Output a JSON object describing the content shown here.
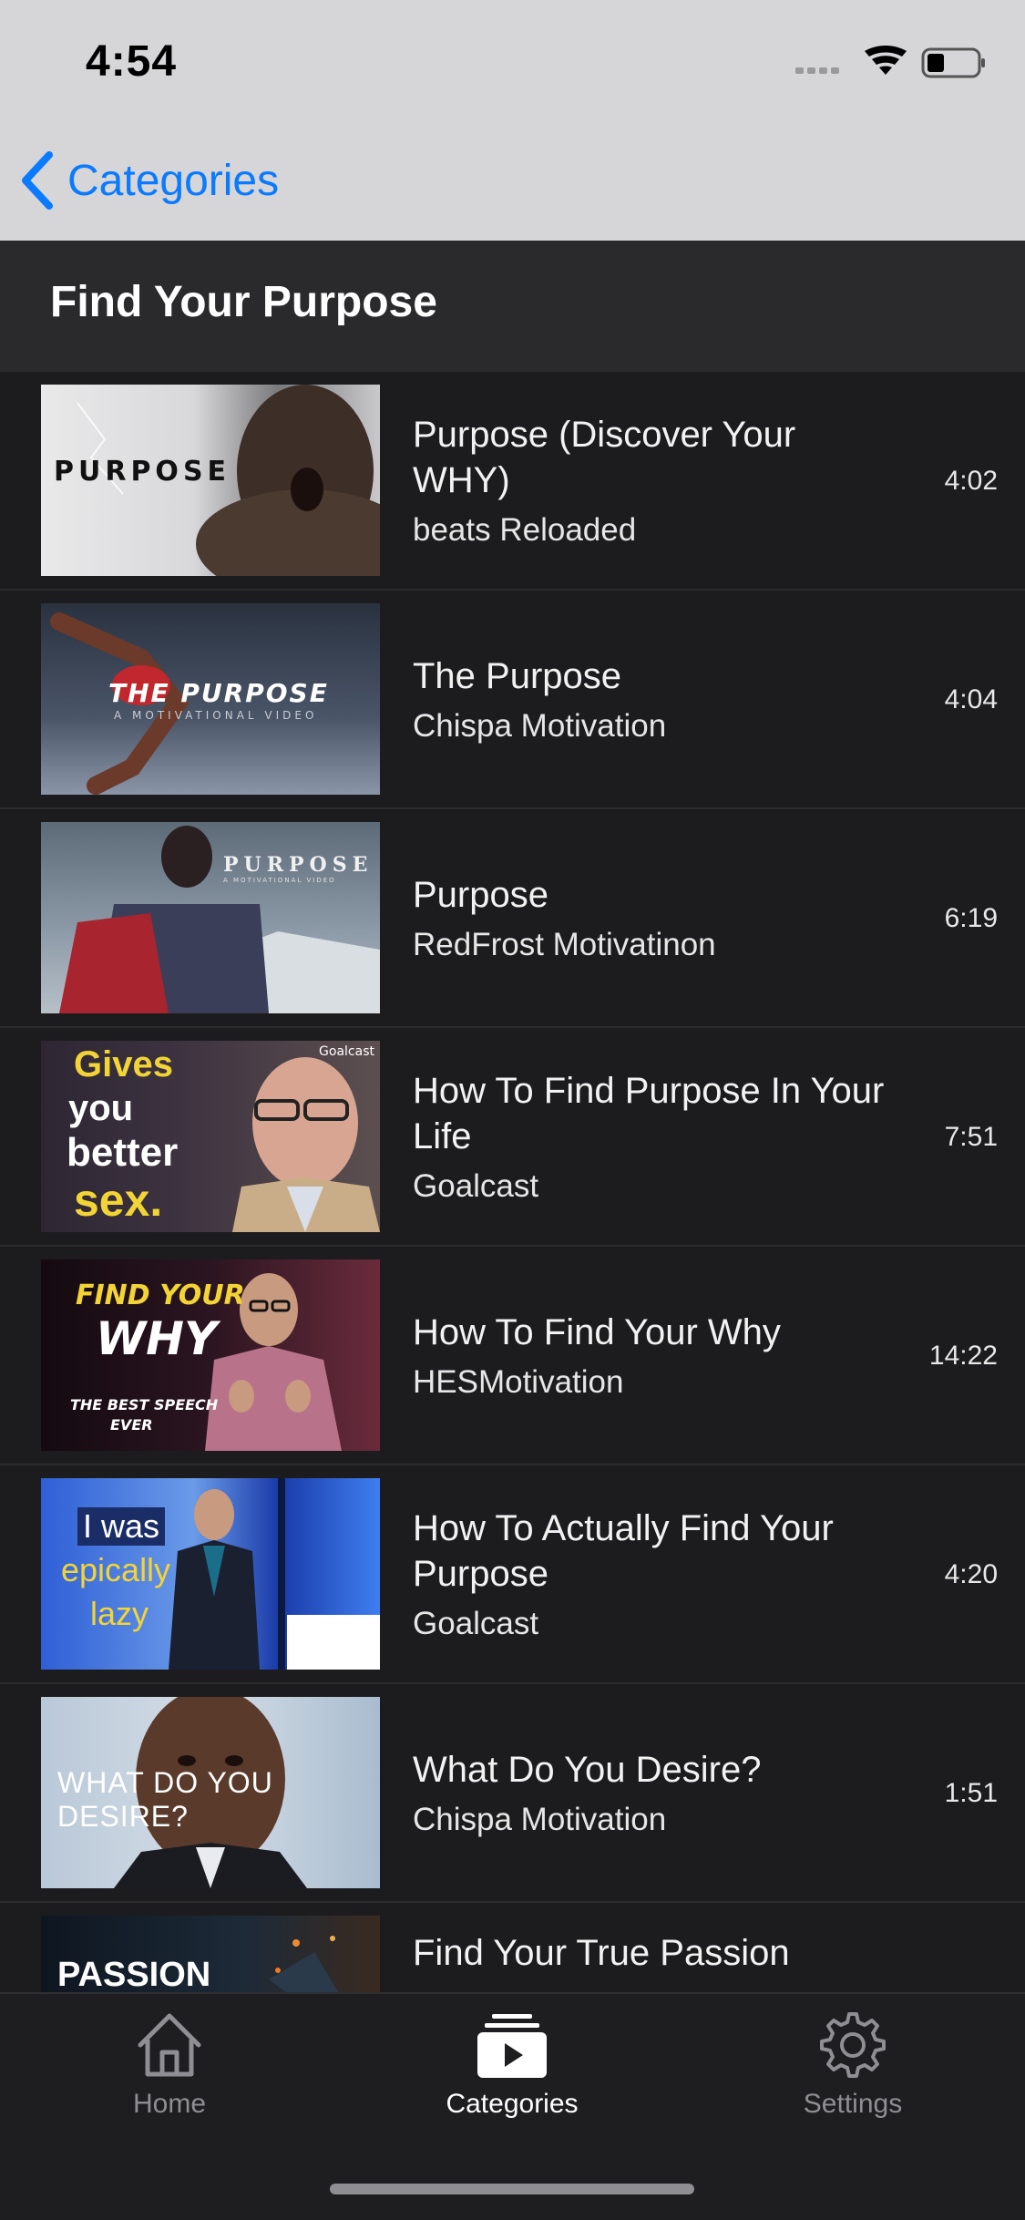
{
  "status_bar": {
    "time": "4:54"
  },
  "nav": {
    "back_label": "Categories"
  },
  "section": {
    "title": "Find Your Purpose"
  },
  "videos": [
    {
      "title": "Purpose (Discover Your WHY)",
      "channel": "beats Reloaded",
      "duration": "4:02",
      "thumb_text": "PURPOSE"
    },
    {
      "title": "The Purpose",
      "channel": "Chispa Motivation",
      "duration": "4:04",
      "thumb_text": "THE PURPOSE",
      "thumb_sub": "A MOTIVATIONAL VIDEO"
    },
    {
      "title": "Purpose",
      "channel": "RedFrost Motivatinon",
      "duration": "6:19",
      "thumb_text": "PURPOSE",
      "thumb_sub": "A MOTIVATIONAL VIDEO"
    },
    {
      "title": "How To Find Purpose In Your Life",
      "channel": "Goalcast",
      "duration": "7:51",
      "thumb_lines": [
        "Gives",
        "you",
        "better",
        "sex."
      ],
      "thumb_brand": "Goalcast"
    },
    {
      "title": "How To Find Your Why",
      "channel": "HESMotivation",
      "duration": "14:22",
      "thumb_lines": [
        "FIND YOUR",
        "WHY",
        "THE BEST SPEECH",
        "EVER"
      ]
    },
    {
      "title": "How To Actually Find Your Purpose",
      "channel": "Goalcast",
      "duration": "4:20",
      "thumb_lines": [
        "I was",
        "epically",
        "lazy"
      ]
    },
    {
      "title": "What Do You Desire?",
      "channel": "Chispa Motivation",
      "duration": "1:51",
      "thumb_text": "WHAT DO YOU DESIRE?"
    },
    {
      "title": "Find Your True Passion",
      "channel": "",
      "duration": "",
      "thumb_text": "PASSION"
    }
  ],
  "tabs": [
    {
      "label": "Home",
      "icon": "house-icon",
      "active": false
    },
    {
      "label": "Categories",
      "icon": "play-stack-icon",
      "active": true
    },
    {
      "label": "Settings",
      "icon": "gear-icon",
      "active": false
    }
  ],
  "colors": {
    "accent": "#0a7aff",
    "background": "#1c1c1e",
    "tab_inactive": "#8e8e93",
    "tab_active": "#ffffff"
  }
}
